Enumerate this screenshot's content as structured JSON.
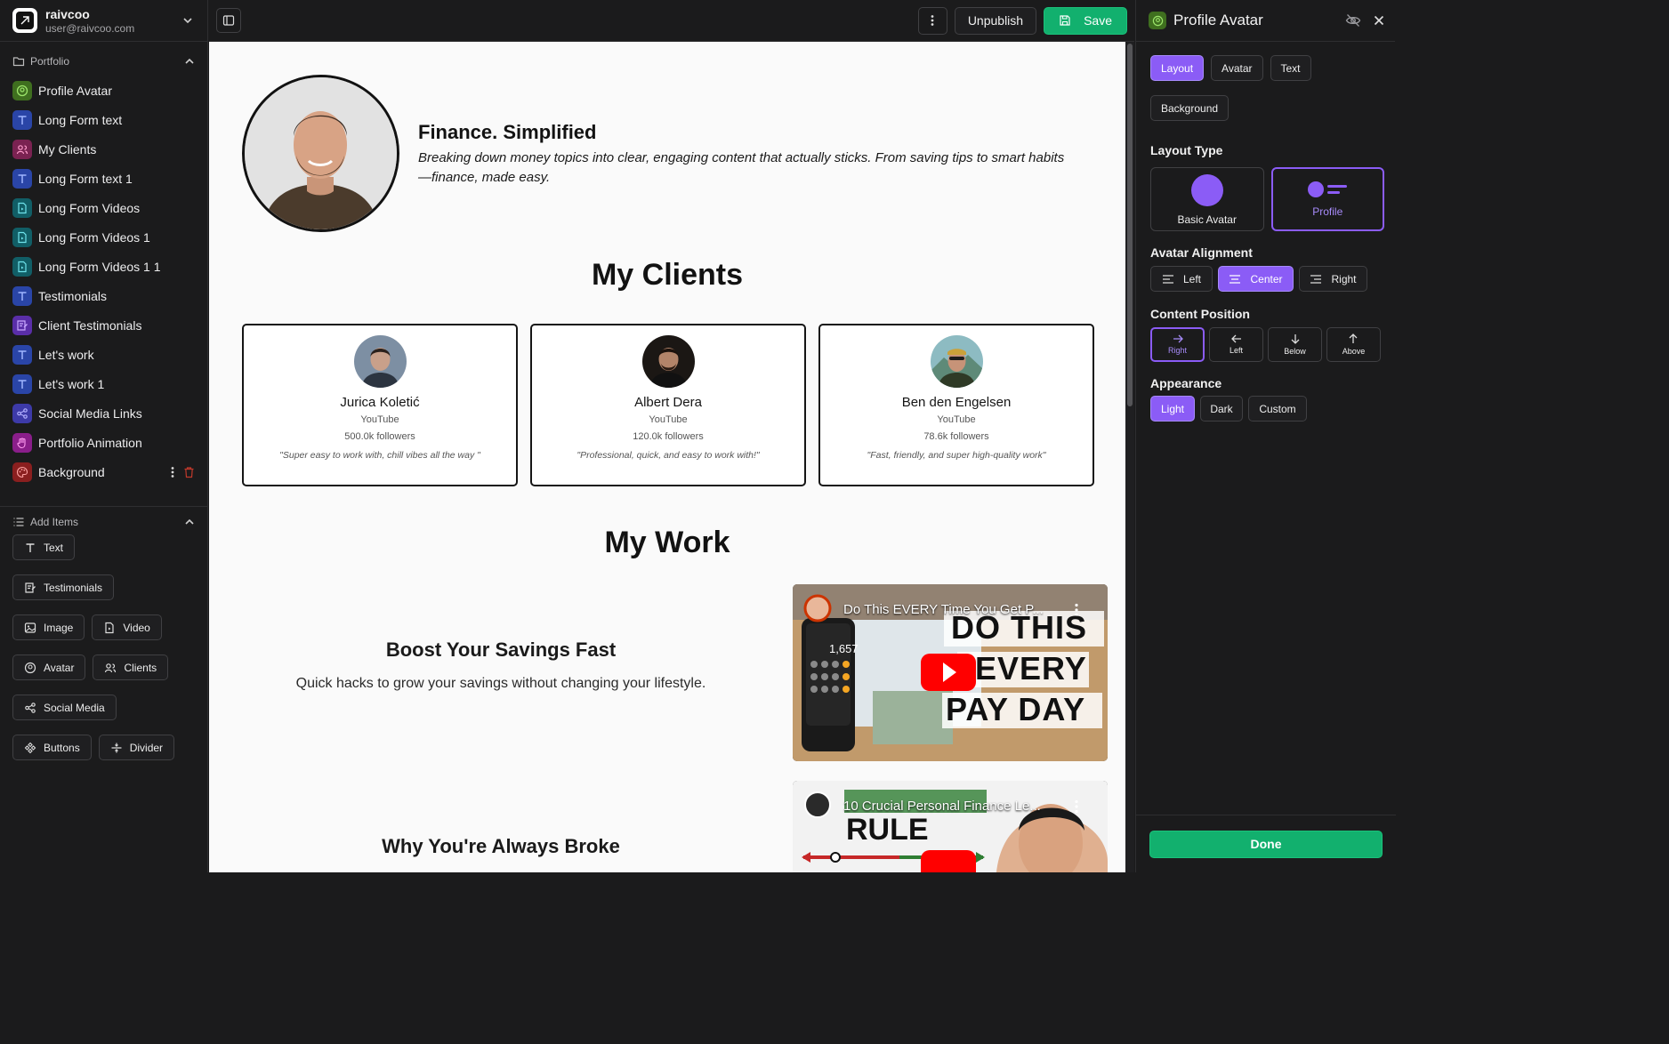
{
  "account": {
    "name": "raivcoo",
    "email": "user@raivcoo.com"
  },
  "sidebar": {
    "section_title": "Portfolio",
    "items": [
      {
        "label": "Profile Avatar",
        "icon": "avatar-icon",
        "color": "#3f6f1f"
      },
      {
        "label": "Long Form text",
        "icon": "text-icon",
        "color": "#2a45a7"
      },
      {
        "label": "My Clients",
        "icon": "users-icon",
        "color": "#7a2251"
      },
      {
        "label": "Long Form text 1",
        "icon": "text-icon",
        "color": "#2a45a7"
      },
      {
        "label": "Long Form Videos",
        "icon": "video-file-icon",
        "color": "#115e66"
      },
      {
        "label": "Long Form Videos 1",
        "icon": "video-file-icon",
        "color": "#115e66"
      },
      {
        "label": "Long Form Videos 1 1",
        "icon": "video-file-icon",
        "color": "#115e66"
      },
      {
        "label": "Testimonials",
        "icon": "text-icon",
        "color": "#2a45a7"
      },
      {
        "label": "Client Testimonials",
        "icon": "testimonial-icon",
        "color": "#5a2ea8"
      },
      {
        "label": "Let's work",
        "icon": "text-icon",
        "color": "#2a45a7"
      },
      {
        "label": "Let's work 1",
        "icon": "text-icon",
        "color": "#2a45a7"
      },
      {
        "label": "Social Media Links",
        "icon": "share-icon",
        "color": "#3d3aa8"
      },
      {
        "label": "Portfolio Animation",
        "icon": "hand-icon",
        "color": "#8a1e8a"
      },
      {
        "label": "Background",
        "icon": "palette-icon",
        "color": "#8a1f1f"
      }
    ],
    "add_title": "Add Items",
    "add_items": [
      "Text",
      "Testimonials",
      "Image",
      "Video",
      "Avatar",
      "Clients",
      "Social Media",
      "Buttons",
      "Divider"
    ]
  },
  "toolbar": {
    "unpublish_label": "Unpublish",
    "save_label": "Save"
  },
  "canvas": {
    "hero": {
      "title": "Finance. Simplified",
      "subtitle": "Breaking down money topics into clear, engaging content that actually sticks. From saving tips to smart habits—finance, made easy."
    },
    "clients_heading": "My Clients",
    "clients": [
      {
        "name": "Jurica Koletić",
        "platform": "YouTube",
        "followers": "500.0k followers",
        "quote": "\"Super easy to work with, chill vibes all the way \""
      },
      {
        "name": "Albert Dera",
        "platform": "YouTube",
        "followers": "120.0k followers",
        "quote": "\"Professional, quick, and easy to work with!\""
      },
      {
        "name": "Ben den Engelsen",
        "platform": "YouTube",
        "followers": "78.6k followers",
        "quote": "\"Fast, friendly, and super high-quality work\""
      }
    ],
    "work_heading": "My Work",
    "works": [
      {
        "title": "Boost Your Savings Fast",
        "description": "Quick hacks to grow your savings without changing your lifestyle.",
        "video_title": "Do This EVERY Time You Get P...",
        "thumb_lines": [
          "DO THIS",
          "EVERY",
          "PAY DAY"
        ],
        "phone_number": "1,657"
      },
      {
        "title": "Why You're Always Broke",
        "description": "",
        "video_title": "10 Crucial Personal Finance Le...",
        "thumb_lines": [
          "RULE"
        ]
      }
    ]
  },
  "panel": {
    "title": "Profile Avatar",
    "tabs": [
      "Layout",
      "Avatar",
      "Text",
      "Background"
    ],
    "active_tab": "Layout",
    "layout_type_label": "Layout Type",
    "layout_types": [
      "Basic Avatar",
      "Profile"
    ],
    "active_layout": "Profile",
    "alignment_label": "Avatar Alignment",
    "alignments": [
      "Left",
      "Center",
      "Right"
    ],
    "active_alignment": "Center",
    "position_label": "Content Position",
    "positions": [
      "Right",
      "Left",
      "Below",
      "Above"
    ],
    "active_position": "Right",
    "appearance_label": "Appearance",
    "appearances": [
      "Light",
      "Dark",
      "Custom"
    ],
    "active_appearance": "Light",
    "done_label": "Done"
  },
  "colors": {
    "accent": "#8b5cf6",
    "save": "#12b06e",
    "youtube_red": "#ff0000"
  }
}
